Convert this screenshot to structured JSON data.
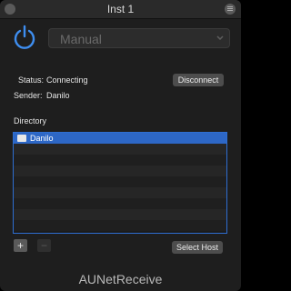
{
  "window": {
    "title": "Inst 1"
  },
  "mode": {
    "value": "Manual"
  },
  "status": {
    "label": "Status:",
    "value": "Connecting",
    "sender_label": "Sender:",
    "sender_value": "Danilo"
  },
  "buttons": {
    "disconnect": "Disconnect",
    "select_host": "Select Host",
    "add": "+",
    "remove": "−"
  },
  "directory": {
    "label": "Directory",
    "items": [
      {
        "name": "Danilo",
        "selected": true
      }
    ]
  },
  "footer": {
    "plugin_name": "AUNetReceive"
  },
  "colors": {
    "accent": "#2d67c6",
    "power": "#3e8ef0"
  },
  "icons": {
    "power": "power-icon",
    "chevron": "chevron-icon",
    "host": "host-icon"
  }
}
